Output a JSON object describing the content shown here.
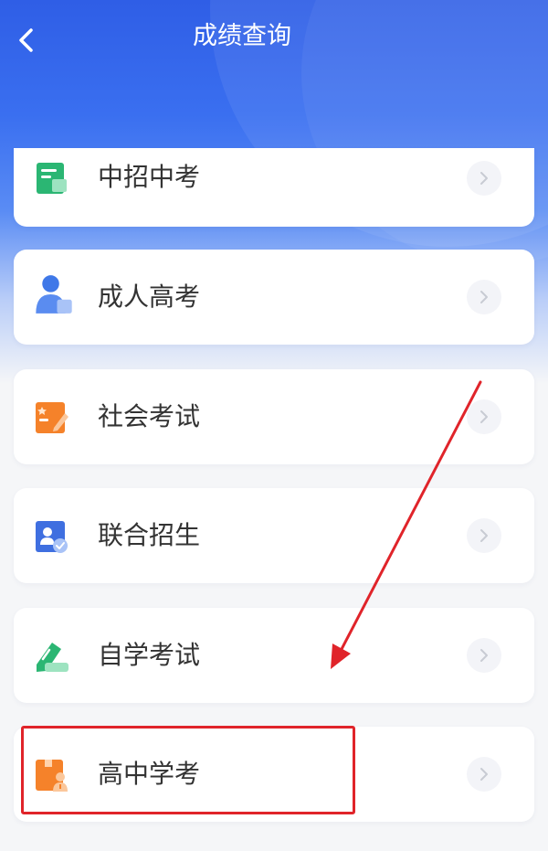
{
  "header": {
    "title": "成绩查询",
    "back_icon": "chevron-left-icon",
    "colors": {
      "primary": "#2f5ee6",
      "title_text": "#ffffff"
    }
  },
  "menu": {
    "items": [
      {
        "label": "中招中考",
        "icon": "document-card-icon",
        "icon_color": "#2bb673"
      },
      {
        "label": "成人高考",
        "icon": "adult-student-icon",
        "icon_color": "#3f78e8"
      },
      {
        "label": "社会考试",
        "icon": "edit-document-icon",
        "icon_color": "#f5822a"
      },
      {
        "label": "联合招生",
        "icon": "user-verified-icon",
        "icon_color": "#3f6fe0"
      },
      {
        "label": "自学考试",
        "icon": "graduation-pen-icon",
        "icon_color": "#2bb673"
      },
      {
        "label": "高中学考",
        "icon": "student-book-icon",
        "icon_color": "#f5822a"
      }
    ],
    "chevron_icon": "chevron-right-icon"
  },
  "annotation": {
    "highlighted_item": "高中学考",
    "color": "#e0242a"
  }
}
